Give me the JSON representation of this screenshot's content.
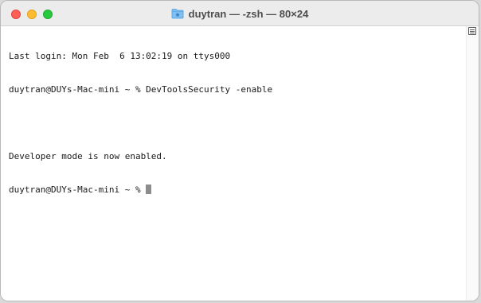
{
  "window": {
    "title": "duytran — -zsh — 80×24",
    "title_icon": "folder-icon",
    "traffic_lights": {
      "close_color": "#fe5f57",
      "minimize_color": "#febc2e",
      "zoom_color": "#28c840"
    }
  },
  "terminal": {
    "lines": [
      "Last login: Mon Feb  6 13:02:19 on ttys000",
      "duytran@DUYs-Mac-mini ~ % DevToolsSecurity -enable",
      "",
      "Developer mode is now enabled.",
      "duytran@DUYs-Mac-mini ~ % "
    ]
  },
  "scrollbar": {
    "marks_icon": "list-icon"
  }
}
